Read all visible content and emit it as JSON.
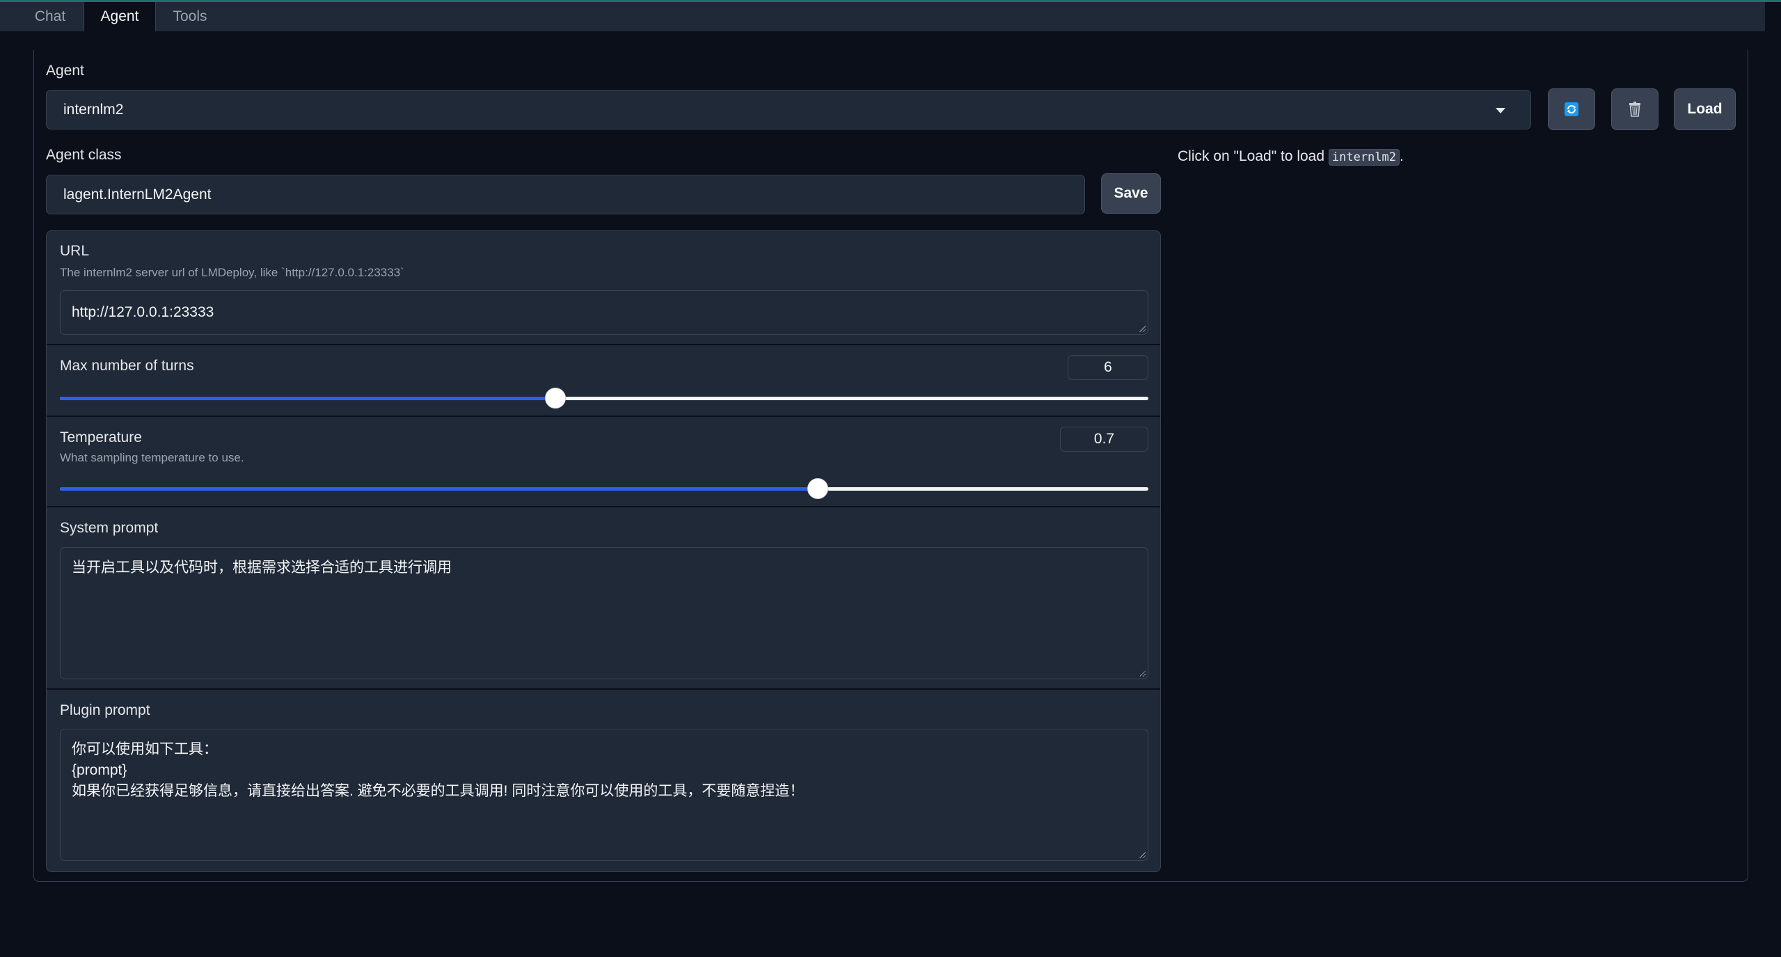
{
  "tabs": [
    {
      "label": "Chat",
      "active": false
    },
    {
      "label": "Agent",
      "active": true
    },
    {
      "label": "Tools",
      "active": false
    }
  ],
  "agent": {
    "label": "Agent",
    "selected": "internlm2",
    "refresh_icon": "refresh-icon",
    "delete_icon": "trash-icon",
    "load_label": "Load"
  },
  "agent_class": {
    "label": "Agent class",
    "value": "lagent.InternLM2Agent",
    "save_label": "Save"
  },
  "load_hint": {
    "prefix": "Click on \"Load\" to load ",
    "code": "internlm2",
    "suffix": "."
  },
  "url": {
    "label": "URL",
    "info": "The internlm2 server url of LMDeploy, like `http://127.0.0.1:23333`",
    "value": "http://127.0.0.1:23333"
  },
  "max_turns": {
    "label": "Max number of turns",
    "value": "6",
    "fraction": 0.455
  },
  "temperature": {
    "label": "Temperature",
    "info": "What sampling temperature to use.",
    "value": "0.7",
    "fraction": 0.696
  },
  "system_prompt": {
    "label": "System prompt",
    "value": "当开启工具以及代码时，根据需求选择合适的工具进行调用"
  },
  "plugin_prompt": {
    "label": "Plugin prompt",
    "value": "你可以使用如下工具：\n{prompt}\n如果你已经获得足够信息，请直接给出答案. 避免不必要的工具调用! 同时注意你可以使用的工具，不要随意捏造！"
  },
  "colors": {
    "background": "#0b0f19",
    "block": "#1f2937",
    "accent": "#2563eb",
    "refresh_icon": "#1e9be9"
  }
}
